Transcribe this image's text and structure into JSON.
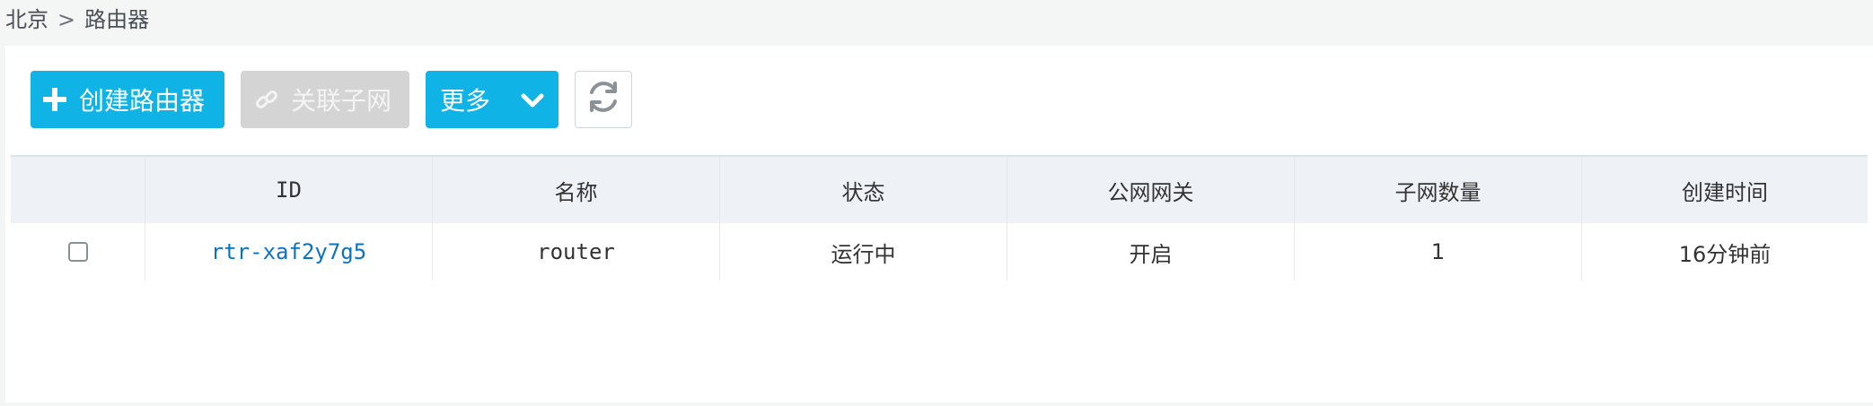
{
  "breadcrumb": {
    "region": "北京",
    "separator": ">",
    "current": "路由器"
  },
  "toolbar": {
    "create_label": "创建路由器",
    "associate_label": "关联子网",
    "more_label": "更多"
  },
  "table": {
    "headers": [
      "",
      "ID",
      "名称",
      "状态",
      "公网网关",
      "子网数量",
      "创建时间"
    ],
    "rows": [
      {
        "checked": false,
        "id": "rtr-xaf2y7g5",
        "name": "router",
        "status": "运行中",
        "public_gateway": "开启",
        "subnet_count": "1",
        "created": "16分钟前"
      }
    ]
  },
  "colors": {
    "primary": "#10b3e6",
    "disabled": "#d4d4d4",
    "link": "#0a73c2",
    "header_bg": "#eef2f7"
  }
}
